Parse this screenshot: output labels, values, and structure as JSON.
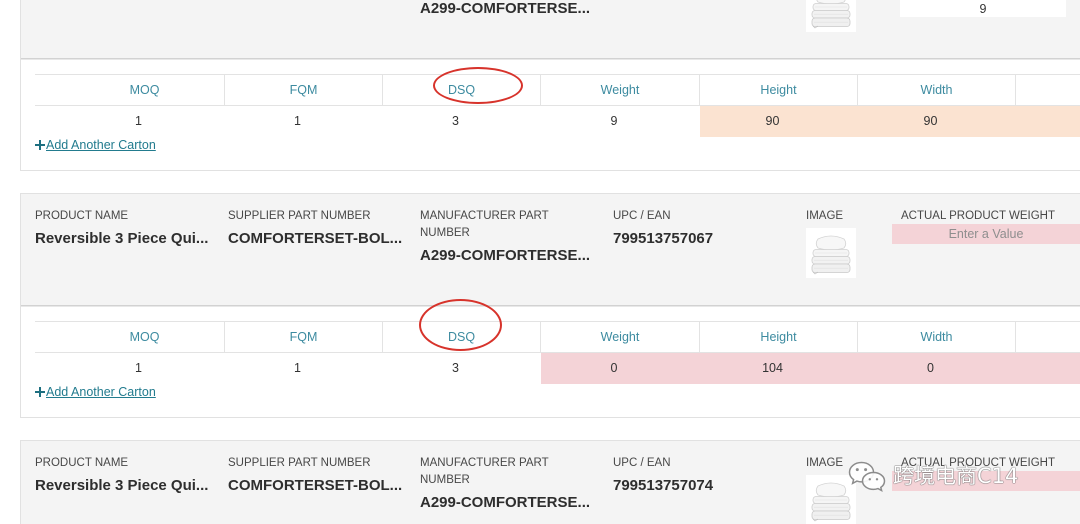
{
  "labels": {
    "product_name": "PRODUCT NAME",
    "supplier_part_number": "SUPPLIER PART NUMBER",
    "manufacturer_part_number": "MANUFACTURER PART NUMBER",
    "upc_ean": "UPC / EAN",
    "image": "IMAGE",
    "actual_product_weight": "ACTUAL PRODUCT WEIGHT"
  },
  "carton_headers": [
    "MOQ",
    "FQM",
    "DSQ",
    "Weight",
    "Height",
    "Width"
  ],
  "add_carton_label": "Add Another Carton",
  "cards": [
    {
      "manufacturer_part_number": "A299-COMFORTERSE...",
      "image_icon": "comforter-thumbnail",
      "actual_product_weight": "9",
      "actual_product_weight_fill": "#ffffff",
      "carton_values": [
        "1",
        "1",
        "3",
        "9",
        "90",
        "90"
      ],
      "carton_cell_fills": [
        null,
        null,
        null,
        null,
        "#fbe3d1",
        "#fbe3d1",
        "#fbe3d1"
      ]
    },
    {
      "product_name": "Reversible 3 Piece Qui...",
      "supplier_part_number": "COMFORTERSET-BOL...",
      "manufacturer_part_number": "A299-COMFORTERSE...",
      "upc_ean": "799513757067",
      "image_icon": "comforter-thumbnail",
      "actual_product_weight_placeholder": "Enter a Value",
      "actual_product_weight_fill": "#f4d3d7",
      "carton_values": [
        "1",
        "1",
        "3",
        "0",
        "104",
        "0"
      ],
      "carton_cell_fills": [
        null,
        null,
        null,
        "#f4d3d7",
        "#f4d3d7",
        "#f4d3d7",
        "#f4d3d7"
      ]
    },
    {
      "product_name": "Reversible 3 Piece Qui...",
      "supplier_part_number": "COMFORTERSET-BOL...",
      "manufacturer_part_number": "A299-COMFORTERSE...",
      "upc_ean": "799513757074",
      "image_icon": "comforter-thumbnail",
      "actual_product_weight_fill": "#f4d3d7"
    }
  ],
  "watermark": {
    "icon": "wechat-icon",
    "text": "跨境电商C14"
  },
  "colors": {
    "accent": "#3d8ba0",
    "link": "#227b8e",
    "panel_bg": "#f4f4f4",
    "warning_bg": "#fbe3d1",
    "error_bg": "#f4d3d7",
    "annotation": "#d7332b"
  }
}
